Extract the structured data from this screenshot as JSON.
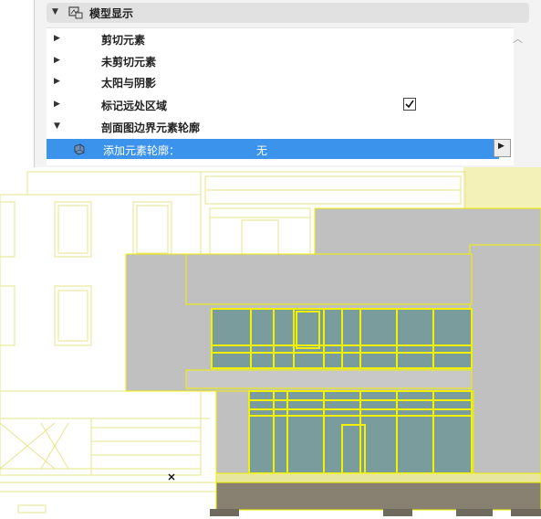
{
  "panel": {
    "section_title": "模型显示",
    "rows": [
      {
        "label": "剪切元素",
        "expanded": false
      },
      {
        "label": "未剪切元素",
        "expanded": false
      },
      {
        "label": "太阳与阴影",
        "expanded": false
      },
      {
        "label": "标记远处区域",
        "expanded": false,
        "checked": true
      },
      {
        "label": "剖面图边界元素轮廓",
        "expanded": true
      }
    ],
    "selected_row": {
      "label": "添加元素轮廓：",
      "value": "无"
    }
  },
  "colors": {
    "selection": "#3c93ec",
    "building_gray": "#c0c0c0",
    "glass": "#7a9c9c",
    "outline_yellow": "#f2f200",
    "sky_yellow": "#f4f1b8",
    "ground": "#888070"
  },
  "icons": [
    "collapse-arrow-icon",
    "display-settings-icon",
    "expand-arrow-icon",
    "checkmark-icon",
    "element-outline-icon",
    "dropdown-arrow-icon",
    "scroll-up-icon",
    "cursor-cross-icon"
  ]
}
